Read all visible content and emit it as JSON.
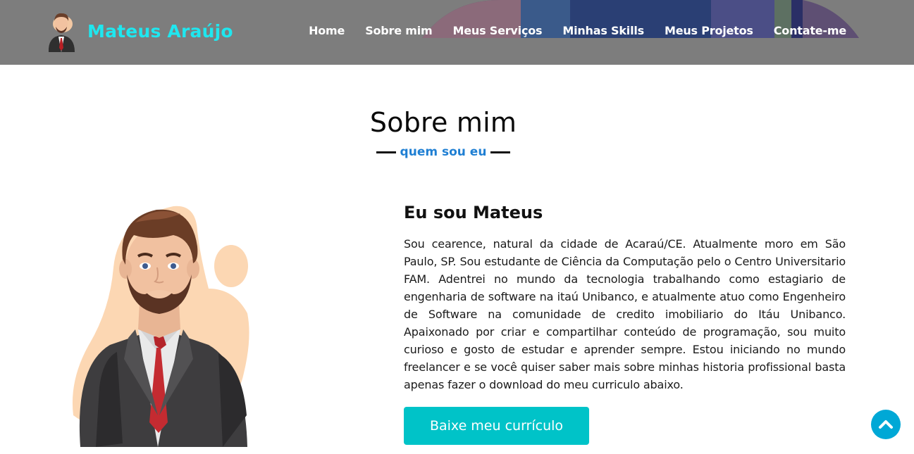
{
  "brand": {
    "name": "Mateus Araújo",
    "avatar_icon": "developer-avatar-icon"
  },
  "nav": {
    "items": [
      {
        "label": "Home"
      },
      {
        "label": "Sobre mim"
      },
      {
        "label": "Meus Serviços"
      },
      {
        "label": "Minhas Skills"
      },
      {
        "label": "Meus Projetos"
      },
      {
        "label": "Contate-me"
      }
    ]
  },
  "about": {
    "title": "Sobre mim",
    "subtitle": "quem sou eu",
    "heading": "Eu sou Mateus",
    "paragraph": "Sou cearence, natural da cidade de Acaraú/CE. Atualmente moro em São Paulo, SP. Sou estudante de Ciência da Computação pelo o Centro Universitario FAM. Adentrei no mundo da tecnologia trabalhando como estagiario de engenharia de software na itaú Unibanco, e atualmente atuo como Engenheiro de Software na comunidade de credito imobiliario do Itáu Unibanco. Apaixonado por criar e compartilhar conteúdo de programação, sou muito curioso e gosto de estudar e aprender sempre. Estou iniciando no mundo freelancer e se você quiser saber mais sobre minhas historia profissional basta apenas fazer o download do meu curriculo abaixo.",
    "cv_button": "Baixe meu currículo"
  },
  "colors": {
    "navbar": "#7d7d7d",
    "brand_accent": "#1fe7ef",
    "subtitle_accent": "#1f7fd3",
    "button": "#00c3c8",
    "scroll_top": "#00a8d6"
  },
  "icons": {
    "scroll_top": "chevron-up-icon"
  }
}
